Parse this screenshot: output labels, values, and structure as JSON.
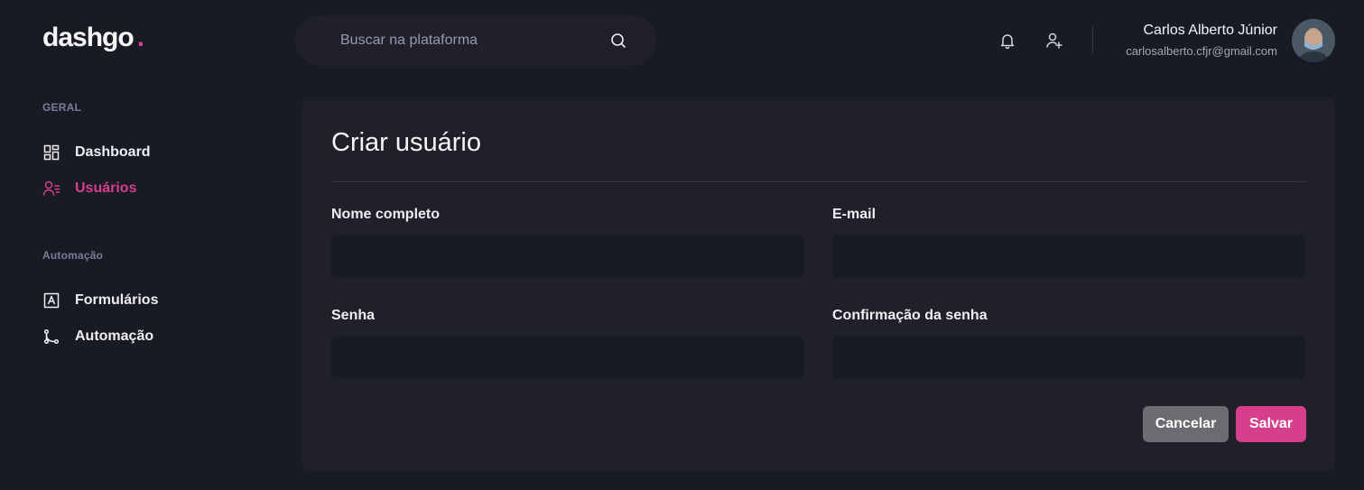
{
  "app": {
    "logo_text": "dashgo",
    "logo_dot": ".",
    "accent_color": "#d53f8c"
  },
  "search": {
    "placeholder": "Buscar na plataforma",
    "value": "",
    "icon": "search-icon"
  },
  "header": {
    "icons": [
      "bell-icon",
      "user-add-icon"
    ]
  },
  "profile": {
    "name": "Carlos Alberto Júnior",
    "email": "carlosalberto.cfjr@gmail.com"
  },
  "sidebar": {
    "sections": [
      {
        "title": "GERAL",
        "items": [
          {
            "label": "Dashboard",
            "icon": "dashboard-grid-icon",
            "active": false
          },
          {
            "label": "Usuários",
            "icon": "users-icon",
            "active": true
          }
        ]
      },
      {
        "title": "Automação",
        "items": [
          {
            "label": "Formulários",
            "icon": "form-icon",
            "active": false
          },
          {
            "label": "Automação",
            "icon": "git-branch-icon",
            "active": false
          }
        ]
      }
    ]
  },
  "form": {
    "title": "Criar usuário",
    "fields": [
      {
        "label": "Nome completo",
        "value": ""
      },
      {
        "label": "E-mail",
        "value": ""
      },
      {
        "label": "Senha",
        "value": ""
      },
      {
        "label": "Confirmação da senha",
        "value": ""
      }
    ],
    "cancel_label": "Cancelar",
    "save_label": "Salvar"
  }
}
